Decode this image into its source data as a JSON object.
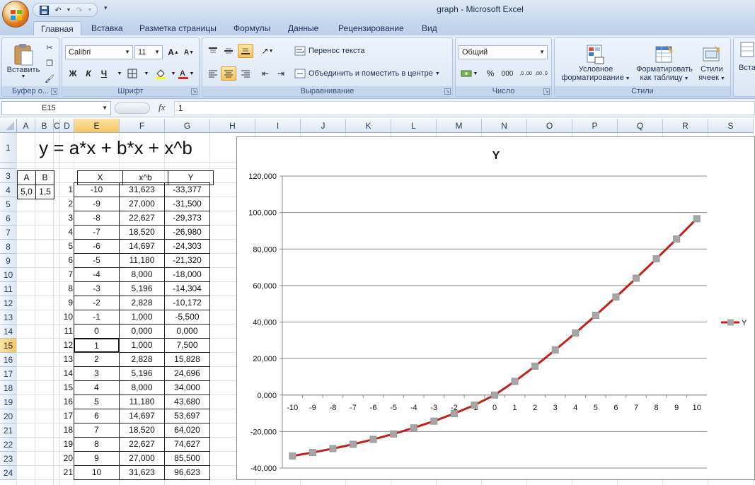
{
  "window": {
    "title": "graph - Microsoft Excel"
  },
  "tabs": [
    "Главная",
    "Вставка",
    "Разметка страницы",
    "Формулы",
    "Данные",
    "Рецензирование",
    "Вид"
  ],
  "ribbon": {
    "clipboard": {
      "label": "Буфер о...",
      "paste": "Вставить"
    },
    "font": {
      "label": "Шрифт",
      "font_name": "Calibri",
      "font_size": "11",
      "bold": "Ж",
      "italic": "К",
      "underline": "Ч"
    },
    "alignment": {
      "label": "Выравнивание",
      "wrap": "Перенос текста",
      "merge": "Объединить и поместить в центре"
    },
    "number": {
      "label": "Число",
      "format": "Общий",
      "percent": "%",
      "thousands": "000",
      "inc": ",0 ,00",
      "dec": ",00 ,0"
    },
    "styles": {
      "label": "Стили",
      "conditional_1": "Условное",
      "conditional_2": "форматирование",
      "table_1": "Форматировать",
      "table_2": "как таблицу",
      "cell_1": "Стили",
      "cell_2": "ячеек"
    },
    "cells": {
      "insert": "Вста"
    }
  },
  "formula_bar": {
    "name_box": "E15",
    "fx": "fx",
    "value": "1"
  },
  "columns": [
    "A",
    "B",
    "C",
    "D",
    "E",
    "F",
    "G",
    "H",
    "I",
    "J",
    "K",
    "L",
    "M",
    "N",
    "O",
    "P",
    "Q",
    "R",
    "S"
  ],
  "rows": [
    "1",
    "2",
    "3",
    "4",
    "5",
    "6",
    "7",
    "8",
    "9",
    "10",
    "11",
    "12",
    "13",
    "14",
    "15",
    "16",
    "17",
    "18",
    "19",
    "20",
    "21",
    "22",
    "23",
    "24"
  ],
  "sheet": {
    "formula_title": "y = a*x + b*x + x^b",
    "params": {
      "a_header": "A",
      "b_header": "B",
      "a_value": "5,0",
      "b_value": "1,5"
    },
    "table_headers": [
      "X",
      "x^b",
      "Y"
    ],
    "table_rows": [
      [
        "1",
        "-10",
        "31,623",
        "-33,377"
      ],
      [
        "2",
        "-9",
        "27,000",
        "-31,500"
      ],
      [
        "3",
        "-8",
        "22,627",
        "-29,373"
      ],
      [
        "4",
        "-7",
        "18,520",
        "-26,980"
      ],
      [
        "5",
        "-6",
        "14,697",
        "-24,303"
      ],
      [
        "6",
        "-5",
        "11,180",
        "-21,320"
      ],
      [
        "7",
        "-4",
        "8,000",
        "-18,000"
      ],
      [
        "8",
        "-3",
        "5,196",
        "-14,304"
      ],
      [
        "9",
        "-2",
        "2,828",
        "-10,172"
      ],
      [
        "10",
        "-1",
        "1,000",
        "-5,500"
      ],
      [
        "11",
        "0",
        "0,000",
        "0,000"
      ],
      [
        "12",
        "1",
        "1,000",
        "7,500"
      ],
      [
        "13",
        "2",
        "2,828",
        "15,828"
      ],
      [
        "14",
        "3",
        "5,196",
        "24,696"
      ],
      [
        "15",
        "4",
        "8,000",
        "34,000"
      ],
      [
        "16",
        "5",
        "11,180",
        "43,680"
      ],
      [
        "17",
        "6",
        "14,697",
        "53,697"
      ],
      [
        "18",
        "7",
        "18,520",
        "64,020"
      ],
      [
        "19",
        "8",
        "22,627",
        "74,627"
      ],
      [
        "20",
        "9",
        "27,000",
        "85,500"
      ],
      [
        "21",
        "10",
        "31,623",
        "96,623"
      ]
    ]
  },
  "chart_data": {
    "type": "line",
    "title": "Y",
    "categories": [
      "-10",
      "-9",
      "-8",
      "-7",
      "-6",
      "-5",
      "-4",
      "-3",
      "-2",
      "-1",
      "0",
      "1",
      "2",
      "3",
      "4",
      "5",
      "6",
      "7",
      "8",
      "9",
      "10"
    ],
    "series": [
      {
        "name": "Y",
        "values": [
          -33.377,
          -31.5,
          -29.373,
          -26.98,
          -24.303,
          -21.32,
          -18.0,
          -14.304,
          -10.172,
          -5.5,
          0.0,
          7.5,
          15.828,
          24.696,
          34.0,
          43.68,
          53.697,
          64.02,
          74.627,
          85.5,
          96.623
        ]
      }
    ],
    "y_ticks": [
      "-40,000",
      "-20,000",
      "0,000",
      "20,000",
      "40,000",
      "60,000",
      "80,000",
      "100,000",
      "120,000"
    ],
    "ylim": [
      -40,
      120
    ],
    "grid": true,
    "legend": "right",
    "colors": {
      "line": "#c0211b",
      "marker": "#a6a6a6"
    }
  }
}
